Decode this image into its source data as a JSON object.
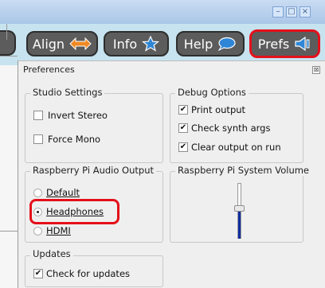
{
  "window": {
    "controls": [
      "–",
      "□",
      "×"
    ]
  },
  "toolbar": {
    "align_label": "Align",
    "info_label": "Info",
    "help_label": "Help",
    "prefs_label": "Prefs"
  },
  "preferences": {
    "title": "Preferences",
    "close_glyph": "⊠",
    "studio_settings": {
      "title": "Studio Settings",
      "invert_stereo": "Invert Stereo",
      "force_mono": "Force Mono"
    },
    "debug_options": {
      "title": "Debug Options",
      "print_output": "Print output",
      "check_synth_args": "Check synth args",
      "clear_output": "Clear output on run"
    },
    "audio_output": {
      "title": "Raspberry Pi Audio Output",
      "options": [
        "Default",
        "Headphones",
        "HDMI"
      ],
      "selected": "Headphones"
    },
    "system_volume": {
      "title": "Raspberry Pi System Volume"
    },
    "updates": {
      "title": "Updates",
      "check_for_updates": "Check for updates"
    }
  },
  "colors": {
    "highlight": "#e4101a",
    "toolbar_bg": "#c6e3ef",
    "button_bg": "#5c5c5c",
    "align_icon": "#f08a24",
    "info_icon": "#2f86d6",
    "help_icon": "#2f86d6",
    "prefs_icon": "#2f86d6",
    "volume_bar": "#0f2fa0"
  }
}
